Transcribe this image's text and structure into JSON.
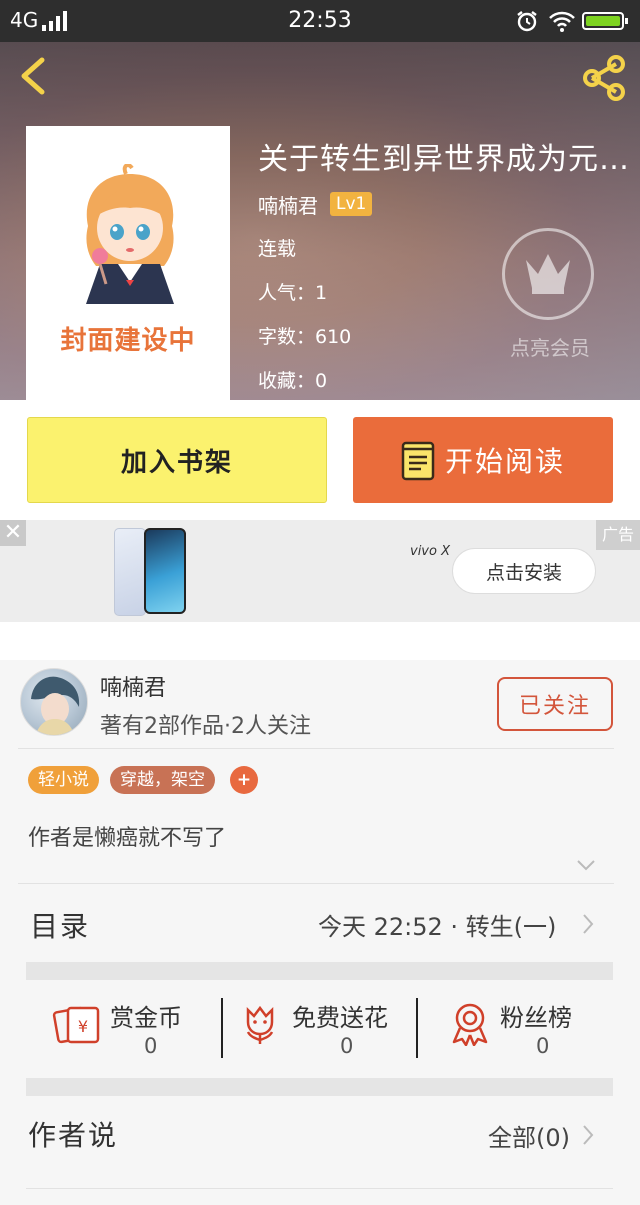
{
  "status_bar": {
    "network": "4G",
    "time": "22:53"
  },
  "book": {
    "title": "关于转生到异世界成为元…",
    "author": "喃楠君",
    "level": "Lv1",
    "status": "连载",
    "popularity": "人气：1",
    "word_count": "字数：610",
    "favorites": "收藏：0",
    "cover_text": "封面建设中"
  },
  "vip": {
    "label": "点亮会员"
  },
  "actions": {
    "add_to_shelf": "加入书架",
    "start_reading": "开始阅读"
  },
  "ad": {
    "brand": "vivo X",
    "install_label": "点击安装",
    "tag": "广告",
    "close": "✕"
  },
  "author_card": {
    "name": "喃楠君",
    "works_summary": "著有2部作品·2人关注",
    "follow_label": "已关注",
    "tags": [
      "轻小说",
      "穿越，架空"
    ],
    "add_tag": "+",
    "intro": "作者是懒癌就不写了"
  },
  "toc": {
    "label": "目录",
    "latest": "今天 22:52 · 转生(一)"
  },
  "stats": [
    {
      "label": "赏金币",
      "value": "0"
    },
    {
      "label": "免费送花",
      "value": "0"
    },
    {
      "label": "粉丝榜",
      "value": "0"
    }
  ],
  "author_says": {
    "label": "作者说",
    "all": "全部(0)"
  },
  "colors": {
    "accent": "#ea6c3b",
    "shelf_button": "#fbf26e",
    "follow": "#d3553b",
    "level_badge": "#f2b340",
    "tag_orange": "#f0a03a",
    "tag_brown": "#c87255",
    "tag_add": "#e8693f"
  }
}
